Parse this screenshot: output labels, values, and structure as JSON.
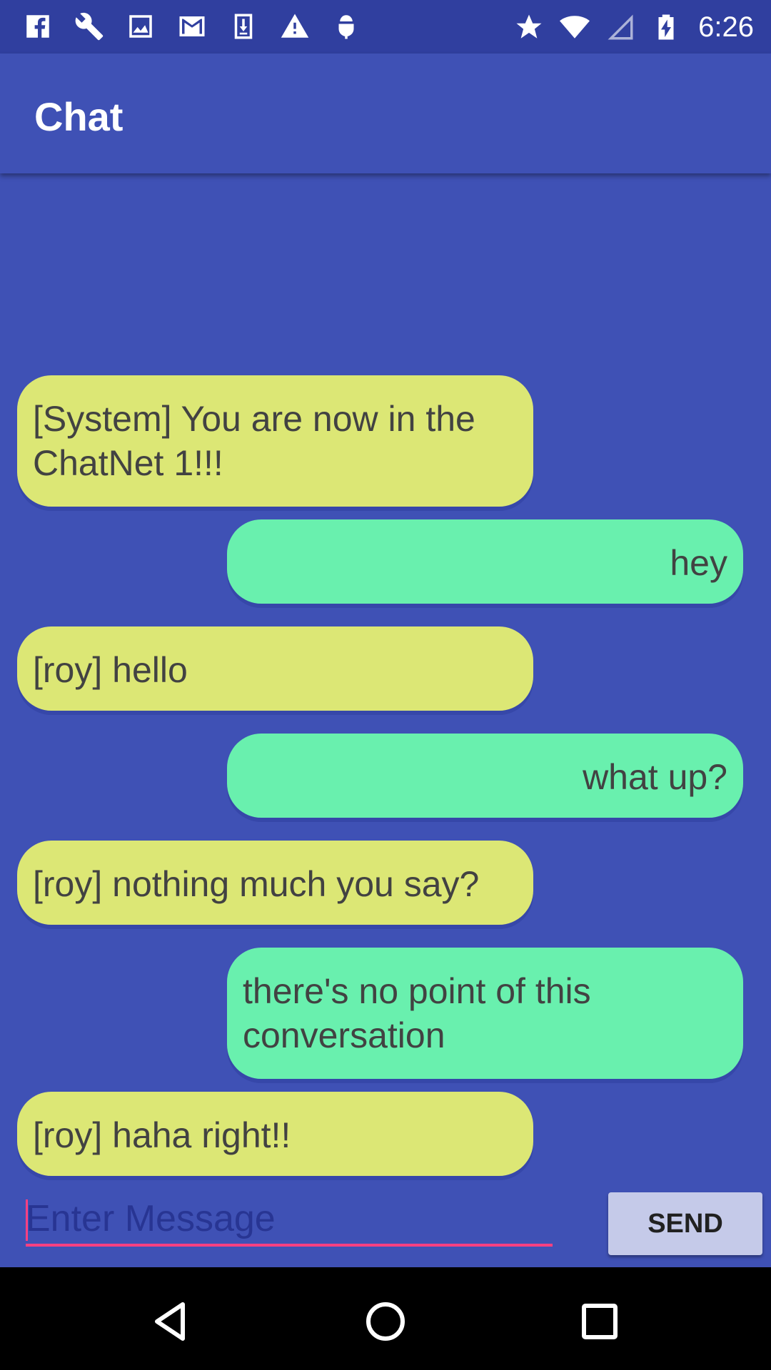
{
  "status_bar": {
    "icons_left": [
      "facebook-icon",
      "wrench-icon",
      "image-icon",
      "gmail-icon",
      "download-icon",
      "warning-icon",
      "android-icon"
    ],
    "icons_right": [
      "star-icon",
      "wifi-icon",
      "cell-signal-icon",
      "battery-charging-icon"
    ],
    "time": "6:26"
  },
  "app_bar": {
    "title": "Chat"
  },
  "messages": [
    {
      "direction": "incoming",
      "text": "[System] You are now in the ChatNet 1!!!"
    },
    {
      "direction": "outgoing",
      "text": "hey"
    },
    {
      "direction": "incoming",
      "text": "[roy] hello"
    },
    {
      "direction": "outgoing",
      "text": "what up?"
    },
    {
      "direction": "incoming",
      "text": "[roy] nothing much you say?"
    },
    {
      "direction": "outgoing",
      "text": "there's no point of this conversation"
    },
    {
      "direction": "incoming",
      "text": "[roy] haha right!!"
    }
  ],
  "composer": {
    "placeholder": "Enter Message",
    "value": "",
    "send_label": "SEND"
  },
  "colors": {
    "primary": "#3F51B5",
    "primary_dark": "#303F9F",
    "accent": "#FF4081",
    "incoming_bubble": "#DCE775",
    "outgoing_bubble": "#69F0AE",
    "send_button": "#C5CAE9"
  },
  "nav_bar": {
    "icons": [
      "back-icon",
      "home-icon",
      "recents-icon"
    ]
  }
}
